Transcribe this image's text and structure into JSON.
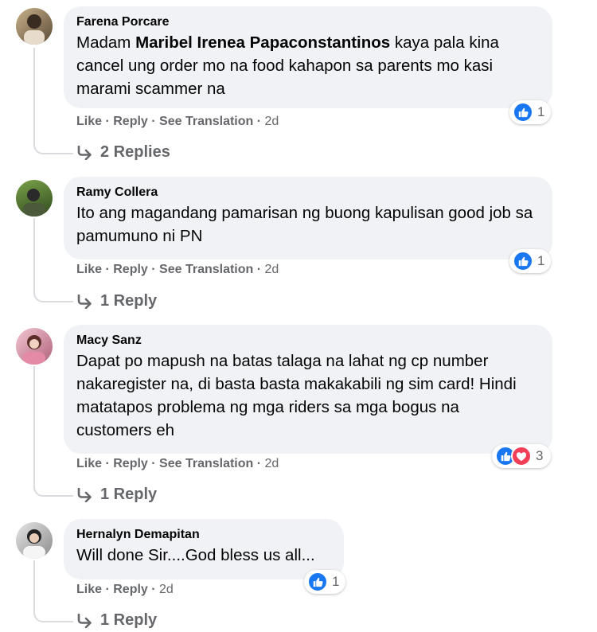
{
  "comments": [
    {
      "author": "Farena Porcare",
      "text_mention": "Maribel Irenea Papaconstantinos",
      "text_before": "Madam ",
      "text_after": " kaya pala kina cancel ung order mo na food kahapon sa parents mo kasi marami scammer na",
      "actions": {
        "like": "Like",
        "reply": "Reply",
        "translate": "See Translation",
        "time": "2d"
      },
      "reactions": {
        "types": [
          "like"
        ],
        "count": "1"
      },
      "replies": "2 Replies"
    },
    {
      "author": "Ramy Collera",
      "text": "Ito ang magandang pamarisan ng buong kapulisan good job sa pamumuno ni PN",
      "actions": {
        "like": "Like",
        "reply": "Reply",
        "translate": "See Translation",
        "time": "2d"
      },
      "reactions": {
        "types": [
          "like"
        ],
        "count": "1"
      },
      "replies": "1 Reply"
    },
    {
      "author": "Macy Sanz",
      "text": "Dapat po mapush na batas talaga na lahat ng cp number nakaregister na, di basta basta makakabili ng sim card! Hindi matatapos problema ng mga riders sa mga bogus na customers eh",
      "actions": {
        "like": "Like",
        "reply": "Reply",
        "translate": "See Translation",
        "time": "2d"
      },
      "reactions": {
        "types": [
          "like",
          "love"
        ],
        "count": "3"
      },
      "replies": "1 Reply"
    },
    {
      "author": "Hernalyn Demapitan",
      "text": "Will done Sir....God bless us all...",
      "actions": {
        "like": "Like",
        "reply": "Reply",
        "time": "2d"
      },
      "reactions": {
        "types": [
          "like"
        ],
        "count": "1"
      },
      "replies": "1 Reply"
    }
  ],
  "colors": {
    "bubble": "#f0f2f5",
    "meta": "#65676b",
    "like_blue": "#1877f2",
    "love_red": "#f33e58"
  },
  "icons": {
    "like": "thumbs-up-icon",
    "love": "heart-icon",
    "reply_arrow": "reply-arrow-icon"
  }
}
